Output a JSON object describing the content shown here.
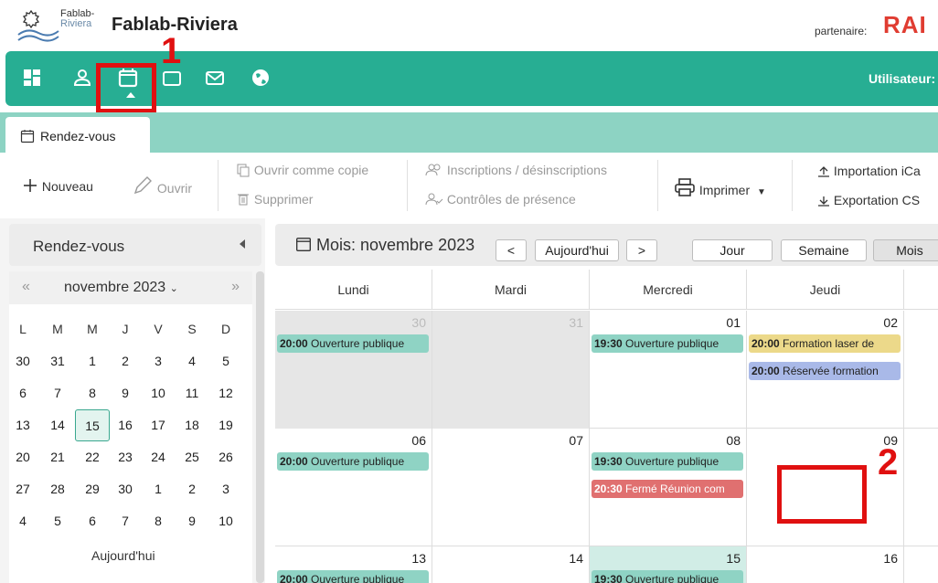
{
  "header": {
    "logo_line1": "Fablab-",
    "logo_line2": "Riviera",
    "brand": "Fablab-Riviera",
    "partner_label": "partenaire:",
    "partner_name": "RAI"
  },
  "navbar": {
    "user_label": "Utilisateur:",
    "accent_color": "#27ae93",
    "icons": [
      "dashboard-icon",
      "user-icon",
      "calendar-icon",
      "folder-icon",
      "mail-icon",
      "globe-icon"
    ]
  },
  "annotations": {
    "one": "1",
    "two": "2",
    "color": "#e01010"
  },
  "tabs": [
    {
      "label": "Rendez-vous"
    }
  ],
  "toolbar": {
    "new": "Nouveau",
    "open": "Ouvrir",
    "open_copy": "Ouvrir comme copie",
    "delete": "Supprimer",
    "registrations": "Inscriptions / désinscriptions",
    "presence": "Contrôles de présence",
    "print": "Imprimer",
    "import": "Importation iCa",
    "export": "Exportation CS"
  },
  "leftpanel": {
    "title": "Rendez-vous",
    "mini_calendar": {
      "prev": "«",
      "next": "»",
      "month": "novembre 2023",
      "weekdays": [
        "L",
        "M",
        "M",
        "J",
        "V",
        "S",
        "D"
      ],
      "weeks": [
        [
          "30",
          "31",
          "1",
          "2",
          "3",
          "4",
          "5"
        ],
        [
          "6",
          "7",
          "8",
          "9",
          "10",
          "11",
          "12"
        ],
        [
          "13",
          "14",
          "15",
          "16",
          "17",
          "18",
          "19"
        ],
        [
          "20",
          "21",
          "22",
          "23",
          "24",
          "25",
          "26"
        ],
        [
          "27",
          "28",
          "29",
          "30",
          "1",
          "2",
          "3"
        ],
        [
          "4",
          "5",
          "6",
          "7",
          "8",
          "9",
          "10"
        ]
      ],
      "selected": "15",
      "today_button": "Aujourd'hui"
    }
  },
  "calendar": {
    "title": "Mois: novembre 2023",
    "prev": "<",
    "today": "Aujourd'hui",
    "next": ">",
    "views": [
      "Jour",
      "Semaine",
      "Mois"
    ],
    "active_view": "Mois",
    "day_headers": [
      "Lundi",
      "Mardi",
      "Mercredi",
      "Jeudi"
    ],
    "weeks": [
      {
        "days": [
          {
            "num": "30",
            "other": true,
            "events": [
              {
                "time": "20:00",
                "title": "Ouverture publique",
                "color": "#8fd3c4"
              }
            ]
          },
          {
            "num": "31",
            "other": true,
            "events": []
          },
          {
            "num": "01",
            "other": false,
            "events": [
              {
                "time": "19:30",
                "title": "Ouverture publique",
                "color": "#8fd3c4"
              }
            ]
          },
          {
            "num": "02",
            "other": false,
            "events": [
              {
                "time": "20:00",
                "title": "Formation laser de",
                "color": "#ecd98a"
              },
              {
                "time": "20:00",
                "title": "Réservée formation",
                "color": "#a9b9e8"
              }
            ]
          }
        ]
      },
      {
        "days": [
          {
            "num": "06",
            "other": false,
            "events": [
              {
                "time": "20:00",
                "title": "Ouverture publique",
                "color": "#8fd3c4"
              }
            ]
          },
          {
            "num": "07",
            "other": false,
            "events": []
          },
          {
            "num": "08",
            "other": false,
            "events": [
              {
                "time": "19:30",
                "title": "Ouverture publique",
                "color": "#8fd3c4"
              },
              {
                "time": "20:30",
                "title": "Fermé Réunion com",
                "color": "#e07070"
              }
            ]
          },
          {
            "num": "09",
            "other": false,
            "events": []
          }
        ]
      },
      {
        "days": [
          {
            "num": "13",
            "other": false,
            "events": [
              {
                "time": "20:00",
                "title": "Ouverture publique",
                "color": "#8fd3c4"
              }
            ]
          },
          {
            "num": "14",
            "other": false,
            "events": []
          },
          {
            "num": "15",
            "other": false,
            "today": true,
            "events": [
              {
                "time": "19:30",
                "title": "Ouverture publique",
                "color": "#8fd3c4"
              }
            ]
          },
          {
            "num": "16",
            "other": false,
            "events": []
          }
        ]
      }
    ]
  }
}
